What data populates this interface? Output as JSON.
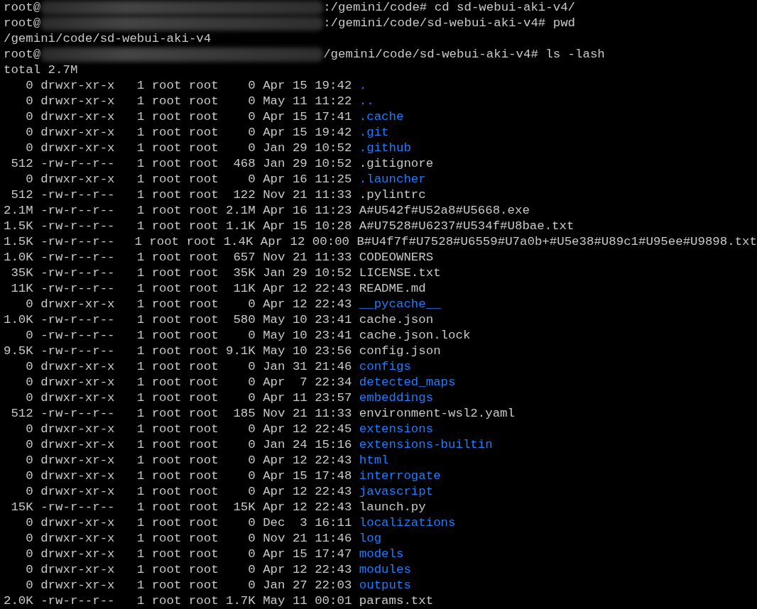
{
  "lines": [
    {
      "kind": "prompt",
      "user": "root@",
      "path": ":/gemini/code#",
      "command": "cd sd-webui-aki-v4/"
    },
    {
      "kind": "prompt",
      "user": "root@",
      "path": ":/gemini/code/sd-webui-aki-v4#",
      "command": "pwd"
    },
    {
      "kind": "output",
      "text": "/gemini/code/sd-webui-aki-v4"
    },
    {
      "kind": "prompt",
      "user": "root@",
      "path": "/gemini/code/sd-webui-aki-v4#",
      "command": "ls -lash"
    },
    {
      "kind": "output",
      "text": "total 2.7M"
    }
  ],
  "listing": [
    {
      "blocks": "0",
      "perms": "drwxr-xr-x",
      "links": "1",
      "owner": "root",
      "group": "root",
      "size": "0",
      "month": "Apr",
      "day": "15",
      "time": "19:42",
      "name": ".",
      "directory": true
    },
    {
      "blocks": "0",
      "perms": "drwxr-xr-x",
      "links": "1",
      "owner": "root",
      "group": "root",
      "size": "0",
      "month": "May",
      "day": "11",
      "time": "11:22",
      "name": "..",
      "directory": true
    },
    {
      "blocks": "0",
      "perms": "drwxr-xr-x",
      "links": "1",
      "owner": "root",
      "group": "root",
      "size": "0",
      "month": "Apr",
      "day": "15",
      "time": "17:41",
      "name": ".cache",
      "directory": true
    },
    {
      "blocks": "0",
      "perms": "drwxr-xr-x",
      "links": "1",
      "owner": "root",
      "group": "root",
      "size": "0",
      "month": "Apr",
      "day": "15",
      "time": "19:42",
      "name": ".git",
      "directory": true
    },
    {
      "blocks": "0",
      "perms": "drwxr-xr-x",
      "links": "1",
      "owner": "root",
      "group": "root",
      "size": "0",
      "month": "Jan",
      "day": "29",
      "time": "10:52",
      "name": ".github",
      "directory": true
    },
    {
      "blocks": "512",
      "perms": "-rw-r--r--",
      "links": "1",
      "owner": "root",
      "group": "root",
      "size": "468",
      "month": "Jan",
      "day": "29",
      "time": "10:52",
      "name": ".gitignore",
      "directory": false
    },
    {
      "blocks": "0",
      "perms": "drwxr-xr-x",
      "links": "1",
      "owner": "root",
      "group": "root",
      "size": "0",
      "month": "Apr",
      "day": "16",
      "time": "11:25",
      "name": ".launcher",
      "directory": true
    },
    {
      "blocks": "512",
      "perms": "-rw-r--r--",
      "links": "1",
      "owner": "root",
      "group": "root",
      "size": "122",
      "month": "Nov",
      "day": "21",
      "time": "11:33",
      "name": ".pylintrc",
      "directory": false
    },
    {
      "blocks": "2.1M",
      "perms": "-rw-r--r--",
      "links": "1",
      "owner": "root",
      "group": "root",
      "size": "2.1M",
      "month": "Apr",
      "day": "16",
      "time": "11:23",
      "name": "A#U542f#U52a8#U5668.exe",
      "directory": false
    },
    {
      "blocks": "1.5K",
      "perms": "-rw-r--r--",
      "links": "1",
      "owner": "root",
      "group": "root",
      "size": "1.1K",
      "month": "Apr",
      "day": "15",
      "time": "10:28",
      "name": "A#U7528#U6237#U534f#U8bae.txt",
      "directory": false
    },
    {
      "blocks": "1.5K",
      "perms": "-rw-r--r--",
      "links": "1",
      "owner": "root",
      "group": "root",
      "size": "1.4K",
      "month": "Apr",
      "day": "12",
      "time": "00:00",
      "name": "B#U4f7f#U7528#U6559#U7a0b+#U5e38#U89c1#U95ee#U9898.txt",
      "directory": false
    },
    {
      "blocks": "1.0K",
      "perms": "-rw-r--r--",
      "links": "1",
      "owner": "root",
      "group": "root",
      "size": "657",
      "month": "Nov",
      "day": "21",
      "time": "11:33",
      "name": "CODEOWNERS",
      "directory": false
    },
    {
      "blocks": "35K",
      "perms": "-rw-r--r--",
      "links": "1",
      "owner": "root",
      "group": "root",
      "size": "35K",
      "month": "Jan",
      "day": "29",
      "time": "10:52",
      "name": "LICENSE.txt",
      "directory": false
    },
    {
      "blocks": "11K",
      "perms": "-rw-r--r--",
      "links": "1",
      "owner": "root",
      "group": "root",
      "size": "11K",
      "month": "Apr",
      "day": "12",
      "time": "22:43",
      "name": "README.md",
      "directory": false
    },
    {
      "blocks": "0",
      "perms": "drwxr-xr-x",
      "links": "1",
      "owner": "root",
      "group": "root",
      "size": "0",
      "month": "Apr",
      "day": "12",
      "time": "22:43",
      "name": "__pycache__",
      "directory": true
    },
    {
      "blocks": "1.0K",
      "perms": "-rw-r--r--",
      "links": "1",
      "owner": "root",
      "group": "root",
      "size": "580",
      "month": "May",
      "day": "10",
      "time": "23:41",
      "name": "cache.json",
      "directory": false
    },
    {
      "blocks": "0",
      "perms": "-rw-r--r--",
      "links": "1",
      "owner": "root",
      "group": "root",
      "size": "0",
      "month": "May",
      "day": "10",
      "time": "23:41",
      "name": "cache.json.lock",
      "directory": false
    },
    {
      "blocks": "9.5K",
      "perms": "-rw-r--r--",
      "links": "1",
      "owner": "root",
      "group": "root",
      "size": "9.1K",
      "month": "May",
      "day": "10",
      "time": "23:56",
      "name": "config.json",
      "directory": false
    },
    {
      "blocks": "0",
      "perms": "drwxr-xr-x",
      "links": "1",
      "owner": "root",
      "group": "root",
      "size": "0",
      "month": "Jan",
      "day": "31",
      "time": "21:46",
      "name": "configs",
      "directory": true
    },
    {
      "blocks": "0",
      "perms": "drwxr-xr-x",
      "links": "1",
      "owner": "root",
      "group": "root",
      "size": "0",
      "month": "Apr",
      "day": "7",
      "time": "22:34",
      "name": "detected_maps",
      "directory": true
    },
    {
      "blocks": "0",
      "perms": "drwxr-xr-x",
      "links": "1",
      "owner": "root",
      "group": "root",
      "size": "0",
      "month": "Apr",
      "day": "11",
      "time": "23:57",
      "name": "embeddings",
      "directory": true
    },
    {
      "blocks": "512",
      "perms": "-rw-r--r--",
      "links": "1",
      "owner": "root",
      "group": "root",
      "size": "185",
      "month": "Nov",
      "day": "21",
      "time": "11:33",
      "name": "environment-wsl2.yaml",
      "directory": false
    },
    {
      "blocks": "0",
      "perms": "drwxr-xr-x",
      "links": "1",
      "owner": "root",
      "group": "root",
      "size": "0",
      "month": "Apr",
      "day": "12",
      "time": "22:45",
      "name": "extensions",
      "directory": true
    },
    {
      "blocks": "0",
      "perms": "drwxr-xr-x",
      "links": "1",
      "owner": "root",
      "group": "root",
      "size": "0",
      "month": "Jan",
      "day": "24",
      "time": "15:16",
      "name": "extensions-builtin",
      "directory": true
    },
    {
      "blocks": "0",
      "perms": "drwxr-xr-x",
      "links": "1",
      "owner": "root",
      "group": "root",
      "size": "0",
      "month": "Apr",
      "day": "12",
      "time": "22:43",
      "name": "html",
      "directory": true
    },
    {
      "blocks": "0",
      "perms": "drwxr-xr-x",
      "links": "1",
      "owner": "root",
      "group": "root",
      "size": "0",
      "month": "Apr",
      "day": "15",
      "time": "17:48",
      "name": "interrogate",
      "directory": true
    },
    {
      "blocks": "0",
      "perms": "drwxr-xr-x",
      "links": "1",
      "owner": "root",
      "group": "root",
      "size": "0",
      "month": "Apr",
      "day": "12",
      "time": "22:43",
      "name": "javascript",
      "directory": true
    },
    {
      "blocks": "15K",
      "perms": "-rw-r--r--",
      "links": "1",
      "owner": "root",
      "group": "root",
      "size": "15K",
      "month": "Apr",
      "day": "12",
      "time": "22:43",
      "name": "launch.py",
      "directory": false
    },
    {
      "blocks": "0",
      "perms": "drwxr-xr-x",
      "links": "1",
      "owner": "root",
      "group": "root",
      "size": "0",
      "month": "Dec",
      "day": "3",
      "time": "16:11",
      "name": "localizations",
      "directory": true
    },
    {
      "blocks": "0",
      "perms": "drwxr-xr-x",
      "links": "1",
      "owner": "root",
      "group": "root",
      "size": "0",
      "month": "Nov",
      "day": "21",
      "time": "11:46",
      "name": "log",
      "directory": true
    },
    {
      "blocks": "0",
      "perms": "drwxr-xr-x",
      "links": "1",
      "owner": "root",
      "group": "root",
      "size": "0",
      "month": "Apr",
      "day": "15",
      "time": "17:47",
      "name": "models",
      "directory": true
    },
    {
      "blocks": "0",
      "perms": "drwxr-xr-x",
      "links": "1",
      "owner": "root",
      "group": "root",
      "size": "0",
      "month": "Apr",
      "day": "12",
      "time": "22:43",
      "name": "modules",
      "directory": true
    },
    {
      "blocks": "0",
      "perms": "drwxr-xr-x",
      "links": "1",
      "owner": "root",
      "group": "root",
      "size": "0",
      "month": "Jan",
      "day": "27",
      "time": "22:03",
      "name": "outputs",
      "directory": true
    },
    {
      "blocks": "2.0K",
      "perms": "-rw-r--r--",
      "links": "1",
      "owner": "root",
      "group": "root",
      "size": "1.7K",
      "month": "May",
      "day": "11",
      "time": "00:01",
      "name": "params.txt",
      "directory": false
    }
  ]
}
